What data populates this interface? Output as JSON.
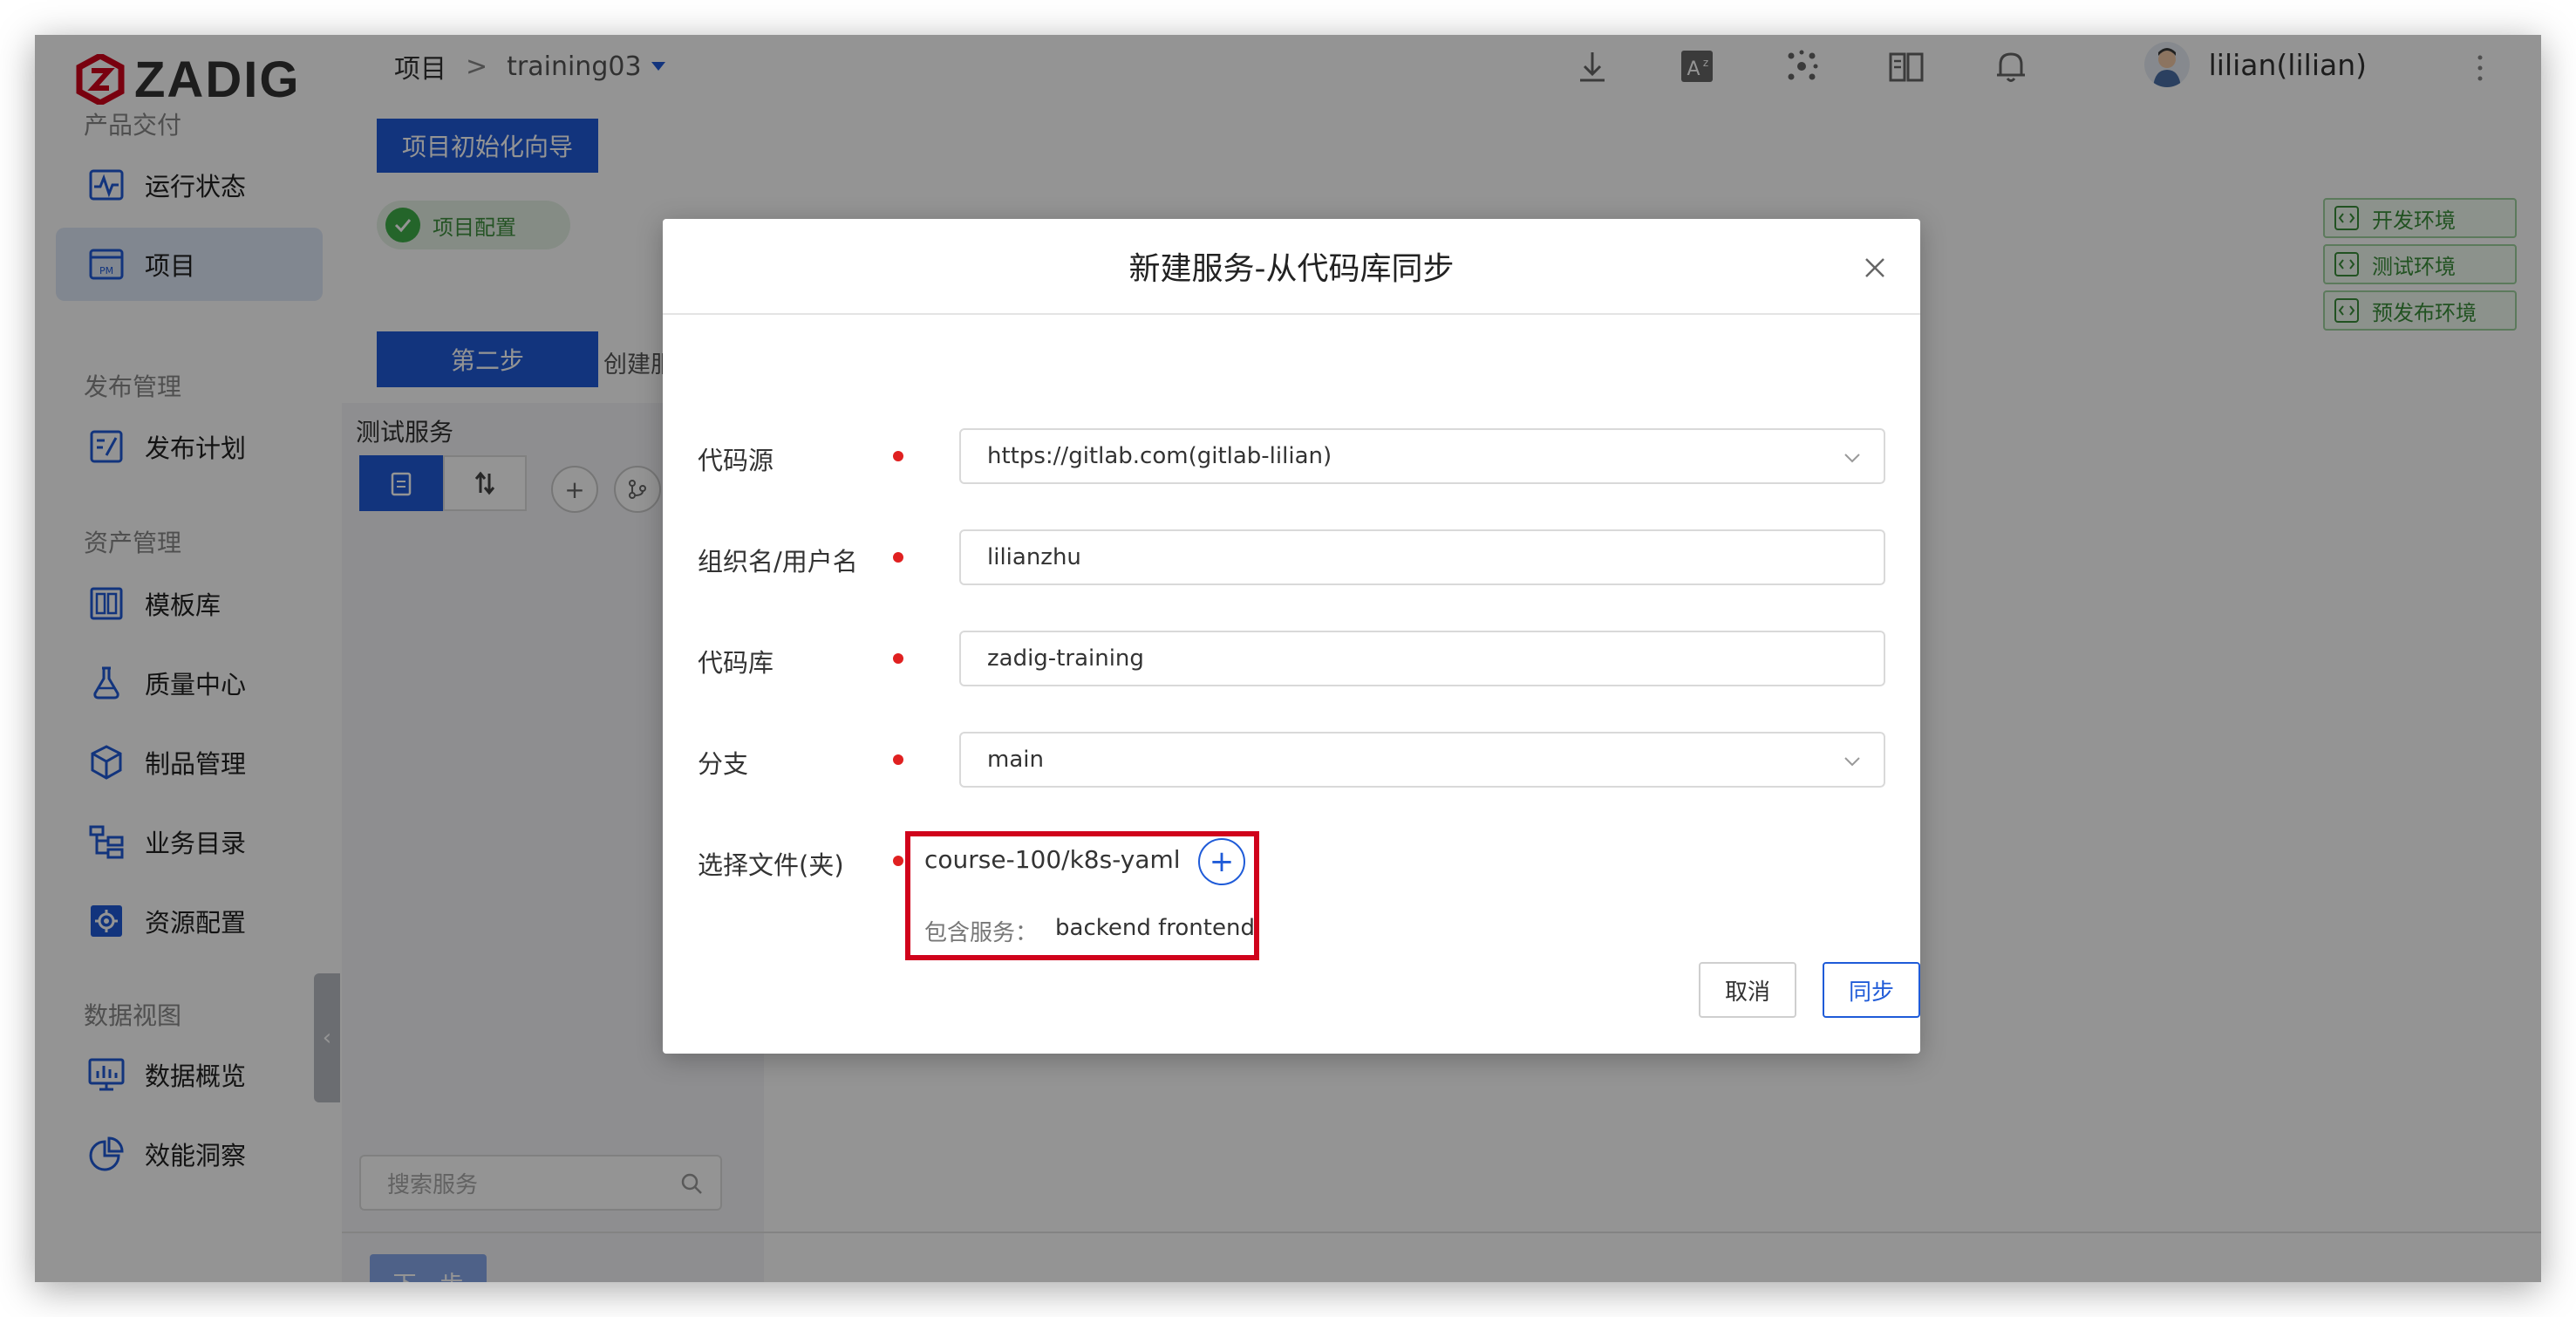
{
  "app": {
    "logo_text": "ZADIG"
  },
  "header": {
    "breadcrumb_root": "项目",
    "breadcrumb_sep": ">",
    "project": "training03",
    "user_name": "lilian(lilian)"
  },
  "sidebar": {
    "groups": {
      "delivery": "产品交付",
      "release": "发布管理",
      "assets": "资产管理",
      "data": "数据视图"
    },
    "items": {
      "status": "运行状态",
      "project": "项目",
      "plan": "发布计划",
      "templates": "模板库",
      "quality": "质量中心",
      "artifacts": "制品管理",
      "catalog": "业务目录",
      "resources": "资源配置",
      "overview": "数据概览",
      "insight": "效能洞察"
    }
  },
  "wizard": {
    "title": "项目初始化向导",
    "step1": "项目配置",
    "step2_button": "第二步",
    "step2_label": "创建服",
    "envs": [
      "开发环境",
      "测试环境",
      "预发布环境"
    ],
    "service_panel_title": "测试服务",
    "search_placeholder": "搜索服务",
    "next_button": "下一步"
  },
  "modal": {
    "title": "新建服务-从代码库同步",
    "fields": {
      "source_label": "代码源",
      "source_value": "https://gitlab.com(gitlab-lilian)",
      "org_label": "组织名/用户名",
      "org_value": "lilianzhu",
      "repo_label": "代码库",
      "repo_value": "zadig-training",
      "branch_label": "分支",
      "branch_value": "main",
      "file_label": "选择文件(夹)",
      "file_value": "course-100/k8s-yaml",
      "contains_label": "包含服务：",
      "contains_value": "backend frontend"
    },
    "cancel": "取消",
    "sync": "同步"
  },
  "colors": {
    "primary": "#1f5bd8",
    "highlight": "#d0021b",
    "required": "#e02020",
    "env_green": "#3a8e3a"
  }
}
